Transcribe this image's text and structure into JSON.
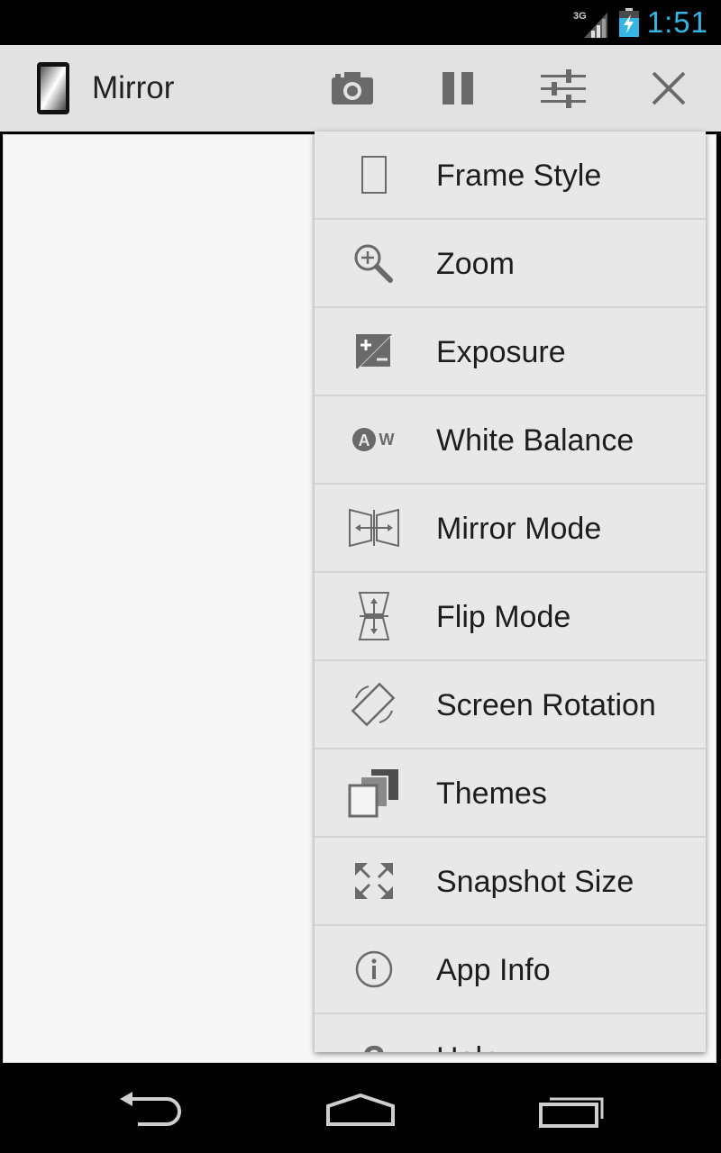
{
  "status_bar": {
    "network": "3G",
    "time": "1:51",
    "icons": [
      "signal-icon",
      "battery-charging-icon"
    ]
  },
  "action_bar": {
    "title": "Mirror",
    "app_icon": "phone-mirror-icon",
    "actions": [
      "camera-icon",
      "pause-icon",
      "sliders-icon",
      "close-icon"
    ]
  },
  "menu": {
    "items": [
      {
        "label": "Frame Style",
        "icon": "frame-icon"
      },
      {
        "label": "Zoom",
        "icon": "zoom-in-icon"
      },
      {
        "label": "Exposure",
        "icon": "exposure-icon"
      },
      {
        "label": "White Balance",
        "icon": "white-balance-icon"
      },
      {
        "label": "Mirror Mode",
        "icon": "mirror-mode-icon"
      },
      {
        "label": "Flip Mode",
        "icon": "flip-mode-icon"
      },
      {
        "label": "Screen Rotation",
        "icon": "screen-rotation-icon"
      },
      {
        "label": "Themes",
        "icon": "themes-icon"
      },
      {
        "label": "Snapshot Size",
        "icon": "snapshot-size-icon"
      },
      {
        "label": "App Info",
        "icon": "info-icon"
      },
      {
        "label": "Help",
        "icon": "help-icon"
      }
    ]
  },
  "nav_bar": {
    "buttons": [
      "back-icon",
      "home-icon",
      "recent-apps-icon"
    ]
  },
  "colors": {
    "accent": "#33b5e5",
    "action_bar": "#e2e2e2",
    "menu_bg": "#e8e8e8",
    "icon_gray": "#6a6a6a"
  }
}
